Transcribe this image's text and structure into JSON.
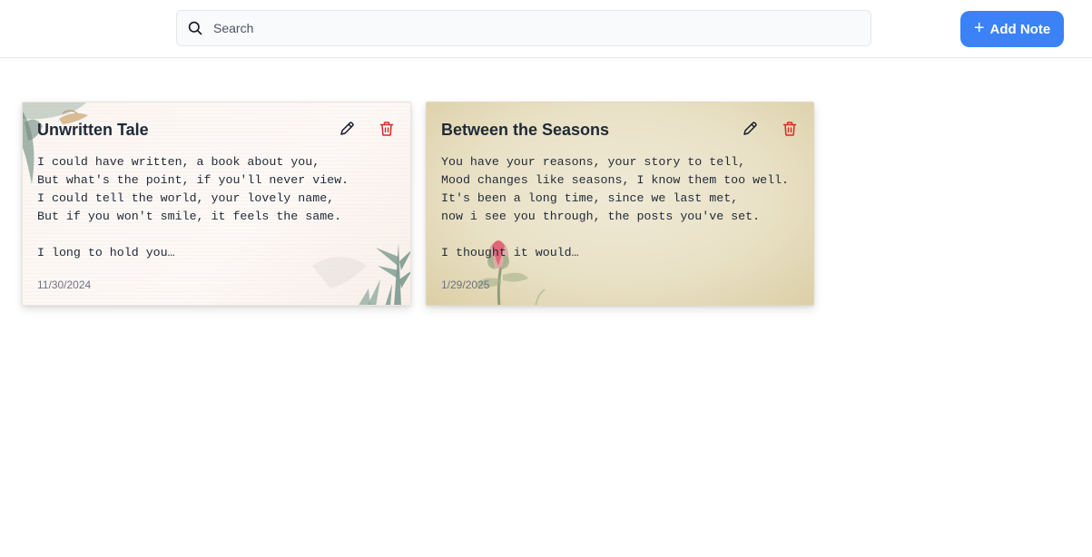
{
  "header": {
    "search": {
      "placeholder": "Search",
      "value": ""
    },
    "add_button": {
      "label": "Add Note",
      "color": "#3b82f6"
    }
  },
  "notes": [
    {
      "title": "Unwritten Tale",
      "preview": "I could have written, a book about you,\nBut what's the point, if you'll never view.\nI could tell the world, your lovely name,\nBut if you won't smile, it feels the same.\n\nI long to hold you…",
      "date": "11/30/2024",
      "theme": "botanical-leaves"
    },
    {
      "title": "Between the Seasons",
      "preview": "You have your reasons, your story to tell,\nMood changes like seasons, I know them too well.\nIt's been a long time, since we last met,\nnow i see you through, the posts you've set.\n\nI thought it would…",
      "date": "1/29/2025",
      "theme": "vintage-rose"
    }
  ],
  "icons": {
    "search": "search-icon",
    "add": "plus-icon",
    "edit": "pencil-icon",
    "delete": "trash-icon"
  },
  "colors": {
    "delete": "#dc2626",
    "edit": "#111827"
  }
}
